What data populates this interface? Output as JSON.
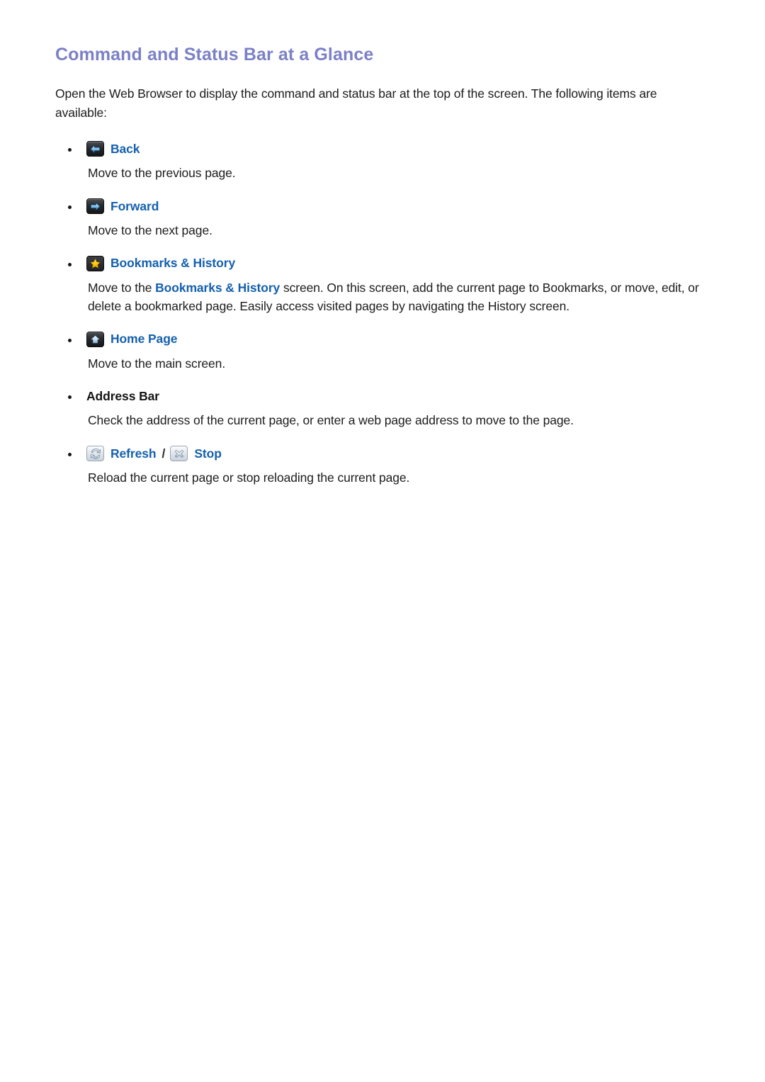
{
  "document": {
    "title": "Command and Status Bar at a Glance",
    "intro": "Open the Web Browser to display the command and status bar at the top of the screen. The following items are available:"
  },
  "colors": {
    "title": "#7b80c7",
    "link": "#1560ad",
    "body": "#1c1c1c",
    "page_background": "#ffffff",
    "icon_dark": "#26282c",
    "icon_light": "#e3e8ee",
    "star_gold": "#ffcc00",
    "arrow_blue": "#2f8ed6"
  },
  "items": [
    {
      "icon": "back-arrow-icon",
      "label": "Back",
      "description": "Move to the previous page."
    },
    {
      "icon": "forward-arrow-icon",
      "label": "Forward",
      "description": "Move to the next page."
    },
    {
      "icon": "star-bookmark-icon",
      "label": "Bookmarks & History",
      "desc_before": "Move to the ",
      "desc_highlight": "Bookmarks & History",
      "desc_after": " screen. On this screen, add the current page to Bookmarks, or move, edit, or delete a bookmarked page. Easily access visited pages by navigating the History screen."
    },
    {
      "icon": "home-icon",
      "label": "Home Page",
      "description": "Move to the main screen."
    },
    {
      "icon": "none",
      "label": "Address Bar",
      "description": "Check the address of the current page, or enter a web page address to move to the page."
    },
    {
      "icon": "refresh-icon",
      "label": "Refresh",
      "separator": "/",
      "icon2": "stop-icon",
      "label2": "Stop",
      "description": "Reload the current page or stop reloading the current page."
    }
  ]
}
